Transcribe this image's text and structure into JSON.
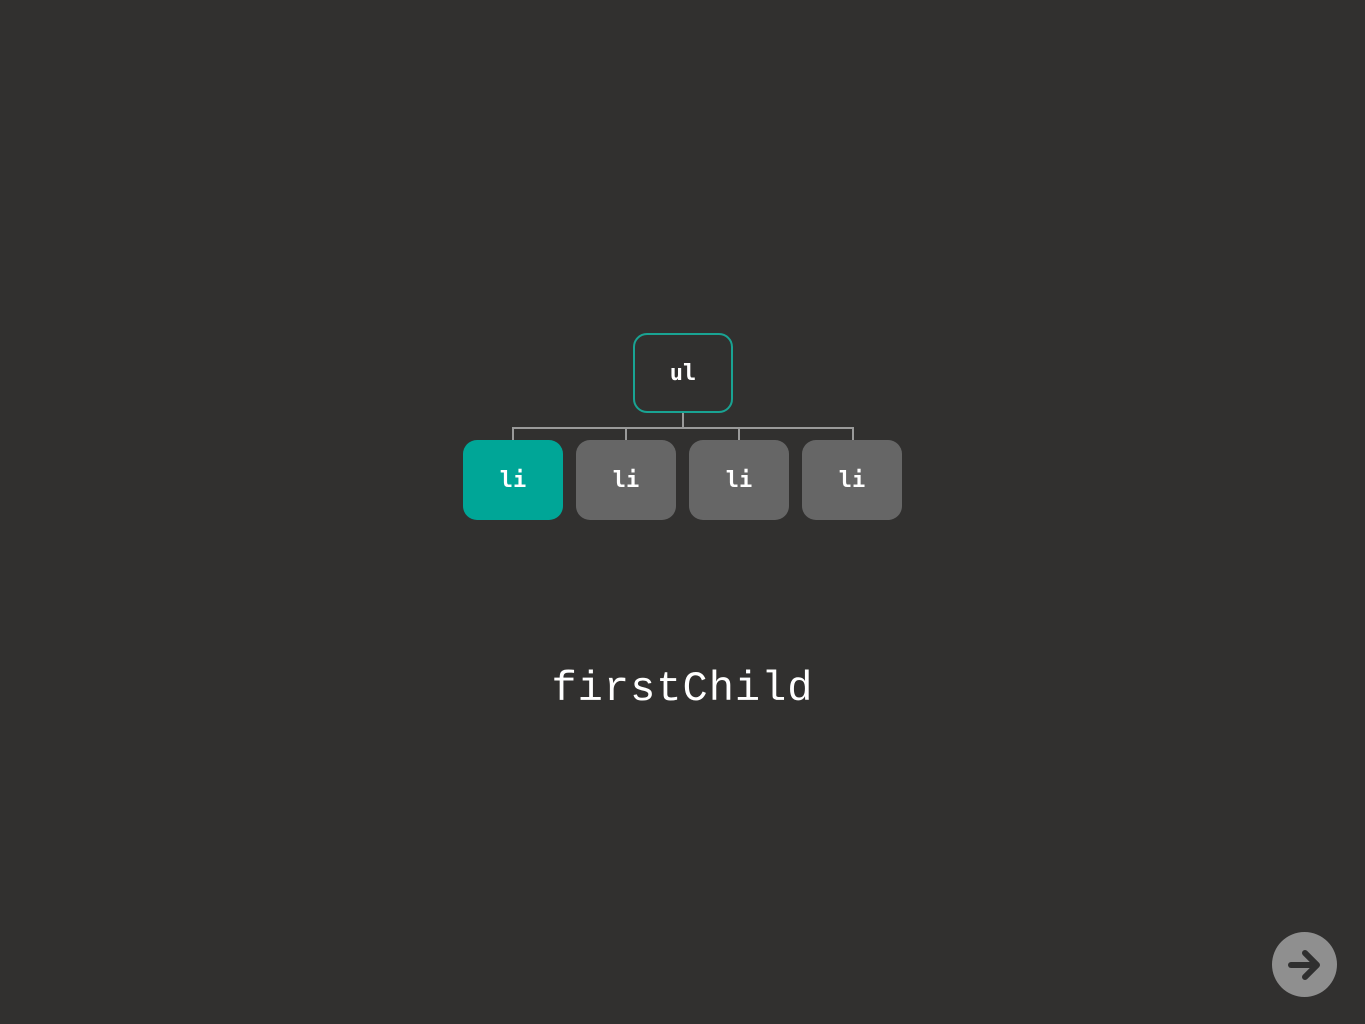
{
  "tree": {
    "parent": {
      "label": "ul"
    },
    "children": [
      {
        "label": "li",
        "highlighted": true
      },
      {
        "label": "li",
        "highlighted": false
      },
      {
        "label": "li",
        "highlighted": false
      },
      {
        "label": "li",
        "highlighted": false
      }
    ]
  },
  "caption": "firstChild",
  "colors": {
    "background": "#31302f",
    "accent": "#00a697",
    "node": "#666666",
    "connector": "#9a9a9a"
  },
  "nav": {
    "icon": "arrow-right-icon"
  }
}
